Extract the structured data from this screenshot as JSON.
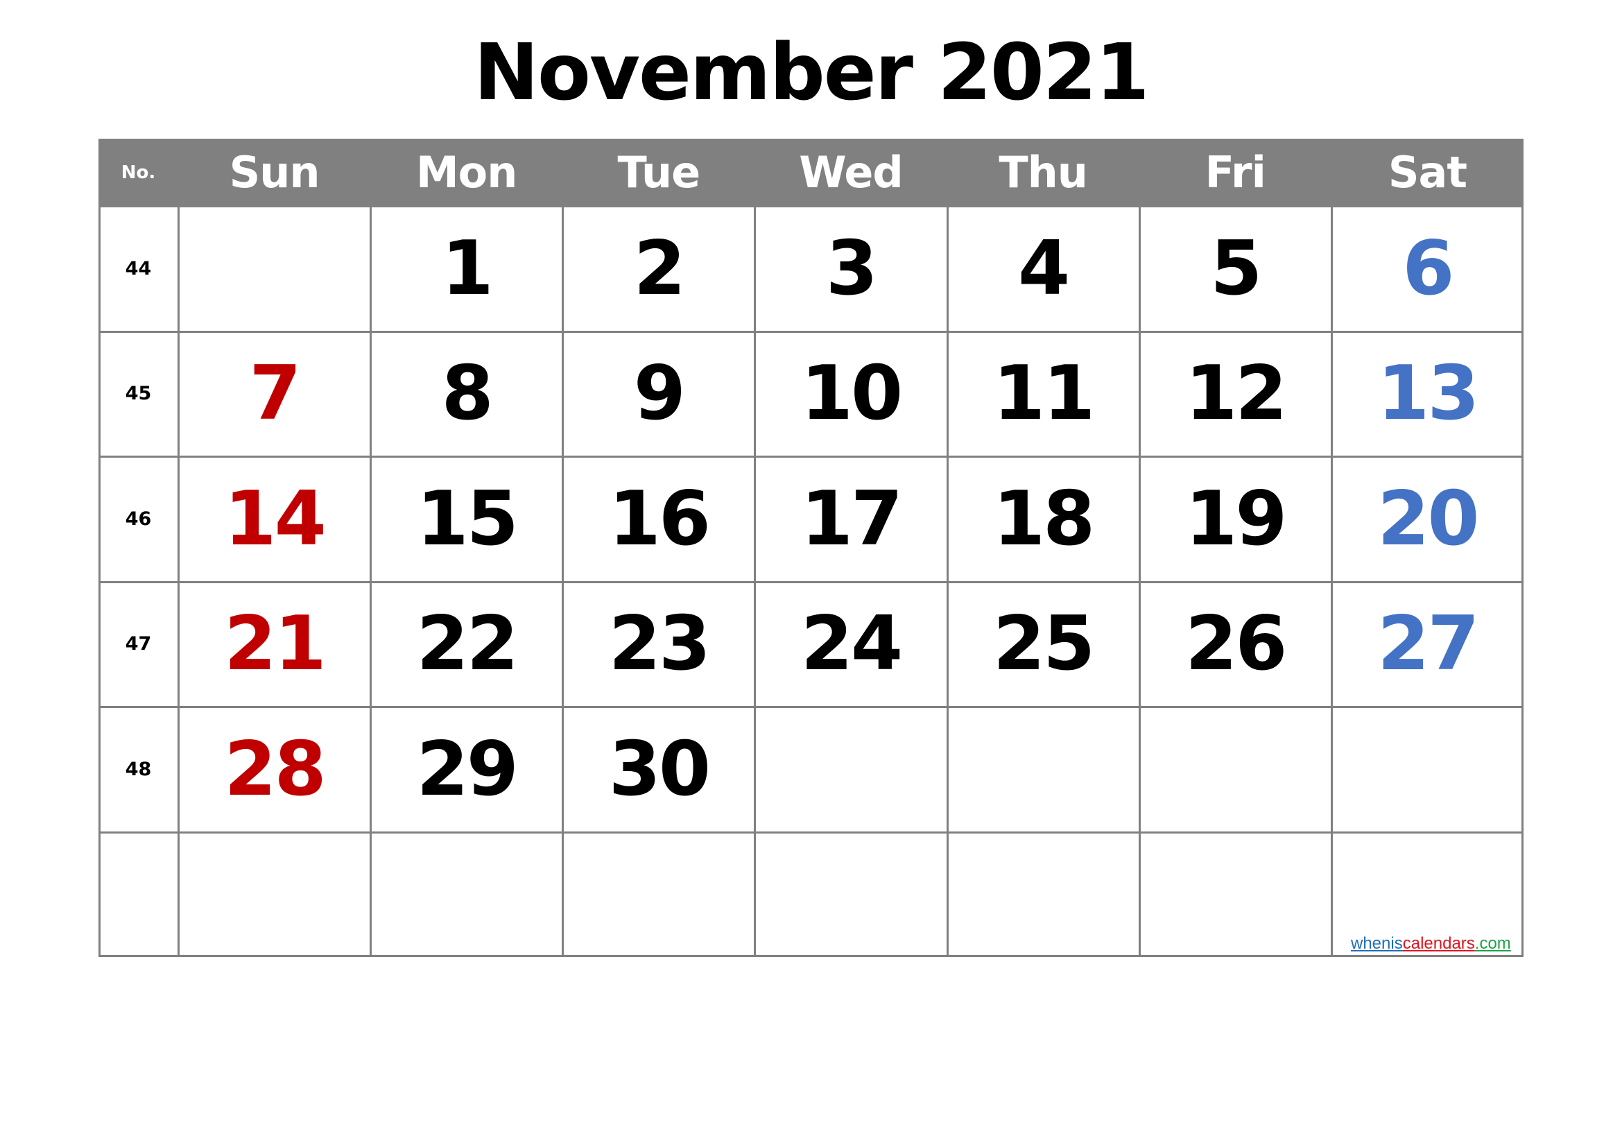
{
  "title": "November 2021",
  "header": {
    "week_label": "No.",
    "days": [
      "Sun",
      "Mon",
      "Tue",
      "Wed",
      "Thu",
      "Fri",
      "Sat"
    ]
  },
  "colors": {
    "header_bg": "#808080",
    "header_text": "#FFFFFF",
    "weekday": "#000000",
    "sunday": "#C00000",
    "saturday": "#4472C4",
    "grid": "#808080"
  },
  "weeks": [
    {
      "no": "44",
      "days": [
        "",
        "1",
        "2",
        "3",
        "4",
        "5",
        "6"
      ]
    },
    {
      "no": "45",
      "days": [
        "7",
        "8",
        "9",
        "10",
        "11",
        "12",
        "13"
      ]
    },
    {
      "no": "46",
      "days": [
        "14",
        "15",
        "16",
        "17",
        "18",
        "19",
        "20"
      ]
    },
    {
      "no": "47",
      "days": [
        "21",
        "22",
        "23",
        "24",
        "25",
        "26",
        "27"
      ]
    },
    {
      "no": "48",
      "days": [
        "28",
        "29",
        "30",
        "",
        "",
        "",
        ""
      ]
    },
    {
      "no": "",
      "days": [
        "",
        "",
        "",
        "",
        "",
        "",
        ""
      ]
    }
  ],
  "watermark": {
    "parts": [
      {
        "text": "whenis",
        "color": "#1F6FB5"
      },
      {
        "text": "calendars",
        "color": "#E0141E"
      },
      {
        "text": ".com",
        "color": "#1EA34A"
      }
    ]
  }
}
